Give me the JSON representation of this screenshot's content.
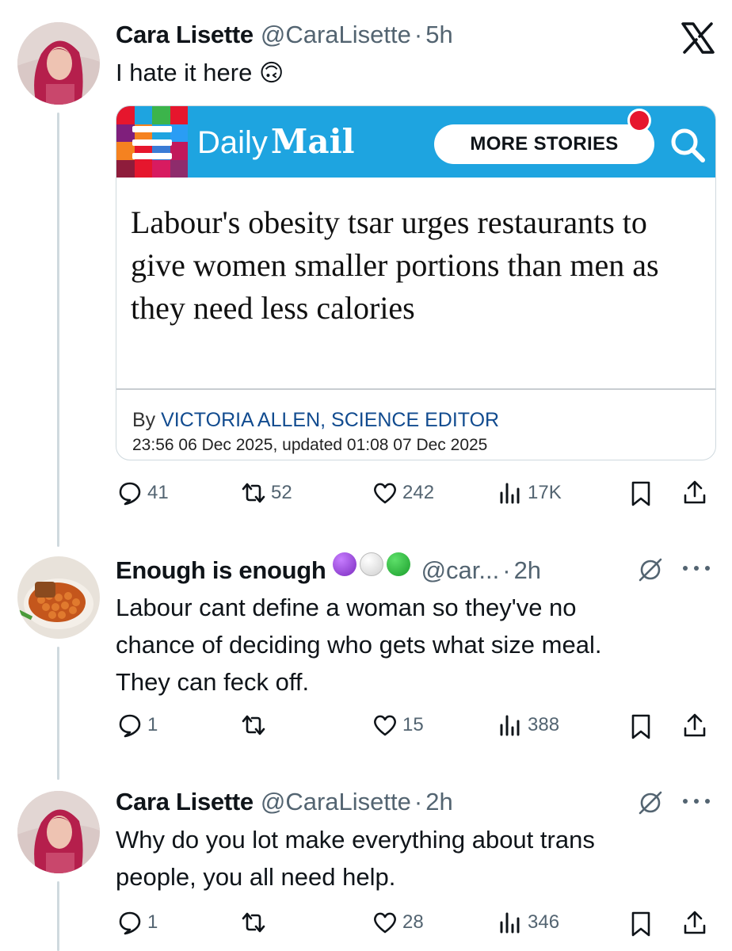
{
  "platform_logo": "x-logo",
  "tweets": [
    {
      "display_name": "Cara Lisette",
      "handle": "@CaraLisette",
      "separator": "·",
      "time": "5h",
      "text": "I hate it here",
      "emoji": "🙃",
      "card": {
        "brand_daily": "Daily",
        "brand_mail": "Mail",
        "more_stories": "MORE STORIES",
        "headline": "Labour's obesity tsar urges restaurants to give women smaller portions than men as they need less calories",
        "byline_prefix": "By ",
        "author": "VICTORIA ALLEN, SCIENCE EDITOR",
        "dateline": "23:56 06 Dec 2025, updated 01:08 07 Dec 2025",
        "colors": {
          "header": "#1ea4e0",
          "alert_dot": "#e6162d"
        }
      },
      "actions": {
        "replies": "41",
        "reposts": "52",
        "likes": "242",
        "views": "17K"
      }
    },
    {
      "display_name": "Enough is enough",
      "name_emojis": [
        "purple-circle",
        "white-circle",
        "green-circle"
      ],
      "handle": "@car...",
      "separator": "·",
      "time": "2h",
      "text_lines": [
        "Labour cant define a woman so they've no",
        "chance of deciding who gets what size meal.",
        "They can feck off."
      ],
      "actions": {
        "replies": "1",
        "reposts": "",
        "likes": "15",
        "views": "388"
      }
    },
    {
      "display_name": "Cara Lisette",
      "handle": "@CaraLisette",
      "separator": "·",
      "time": "2h",
      "text_lines": [
        "Why do you lot make everything about trans",
        "people, you all need help."
      ],
      "actions": {
        "replies": "1",
        "reposts": "",
        "likes": "28",
        "views": "346"
      }
    }
  ],
  "icons": [
    "reply-icon",
    "repost-icon",
    "like-icon",
    "views-icon",
    "bookmark-icon",
    "share-icon",
    "grok-icon",
    "more-icon"
  ]
}
